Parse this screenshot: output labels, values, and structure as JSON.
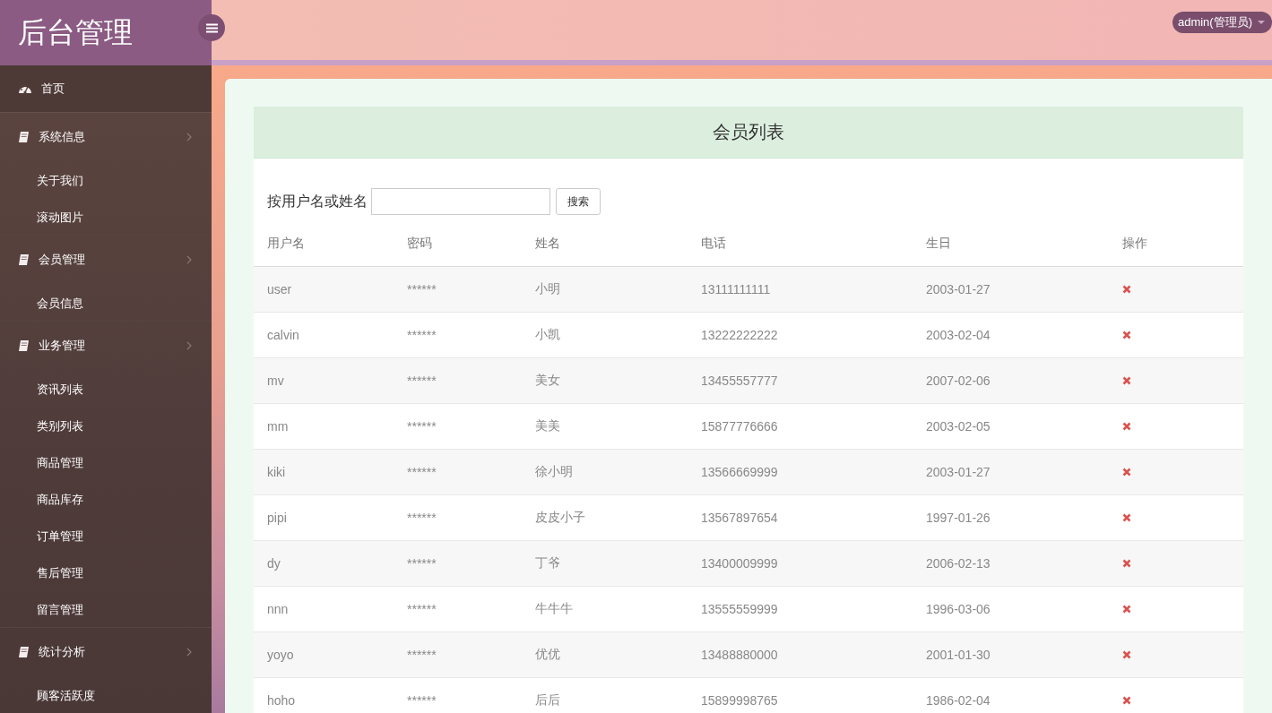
{
  "brand": {
    "title": "后台管理"
  },
  "user_menu": {
    "label": "admin(管理员)"
  },
  "sidebar": {
    "items": [
      {
        "kind": "link",
        "label": "首页"
      },
      {
        "kind": "group",
        "label": "系统信息",
        "children": [
          {
            "label": "关于我们"
          },
          {
            "label": "滚动图片"
          }
        ]
      },
      {
        "kind": "group",
        "label": "会员管理",
        "children": [
          {
            "label": "会员信息"
          }
        ]
      },
      {
        "kind": "group",
        "label": "业务管理",
        "children": [
          {
            "label": "资讯列表"
          },
          {
            "label": "类别列表"
          },
          {
            "label": "商品管理"
          },
          {
            "label": "商品库存"
          },
          {
            "label": "订单管理"
          },
          {
            "label": "售后管理"
          },
          {
            "label": "留言管理"
          }
        ]
      },
      {
        "kind": "group",
        "label": "统计分析",
        "children": [
          {
            "label": "顾客活跃度"
          }
        ]
      }
    ]
  },
  "panel": {
    "title": "会员列表",
    "search": {
      "label": "按用户名或姓名",
      "button": "搜索"
    },
    "table": {
      "columns": [
        "用户名",
        "密码",
        "姓名",
        "电话",
        "生日",
        "操作"
      ],
      "rows": [
        {
          "cells": [
            "user",
            "******",
            "小明",
            "13111111111",
            "2003-01-27"
          ]
        },
        {
          "cells": [
            "calvin",
            "******",
            "小凯",
            "13222222222",
            "2003-02-04"
          ]
        },
        {
          "cells": [
            "mv",
            "******",
            "美女",
            "13455557777",
            "2007-02-06"
          ]
        },
        {
          "cells": [
            "mm",
            "******",
            "美美",
            "15877776666",
            "2003-02-05"
          ]
        },
        {
          "cells": [
            "kiki",
            "******",
            "徐小明",
            "13566669999",
            "2003-01-27"
          ]
        },
        {
          "cells": [
            "pipi",
            "******",
            "皮皮小子",
            "13567897654",
            "1997-01-26"
          ]
        },
        {
          "cells": [
            "dy",
            "******",
            "丁爷",
            "13400009999",
            "2006-02-13"
          ]
        },
        {
          "cells": [
            "nnn",
            "******",
            "牛牛牛",
            "13555559999",
            "1996-03-06"
          ]
        },
        {
          "cells": [
            "yoyo",
            "******",
            "优优",
            "13488880000",
            "2001-01-30"
          ]
        },
        {
          "cells": [
            "hoho",
            "******",
            "后后",
            "15899998765",
            "1986-02-04"
          ]
        }
      ]
    }
  }
}
